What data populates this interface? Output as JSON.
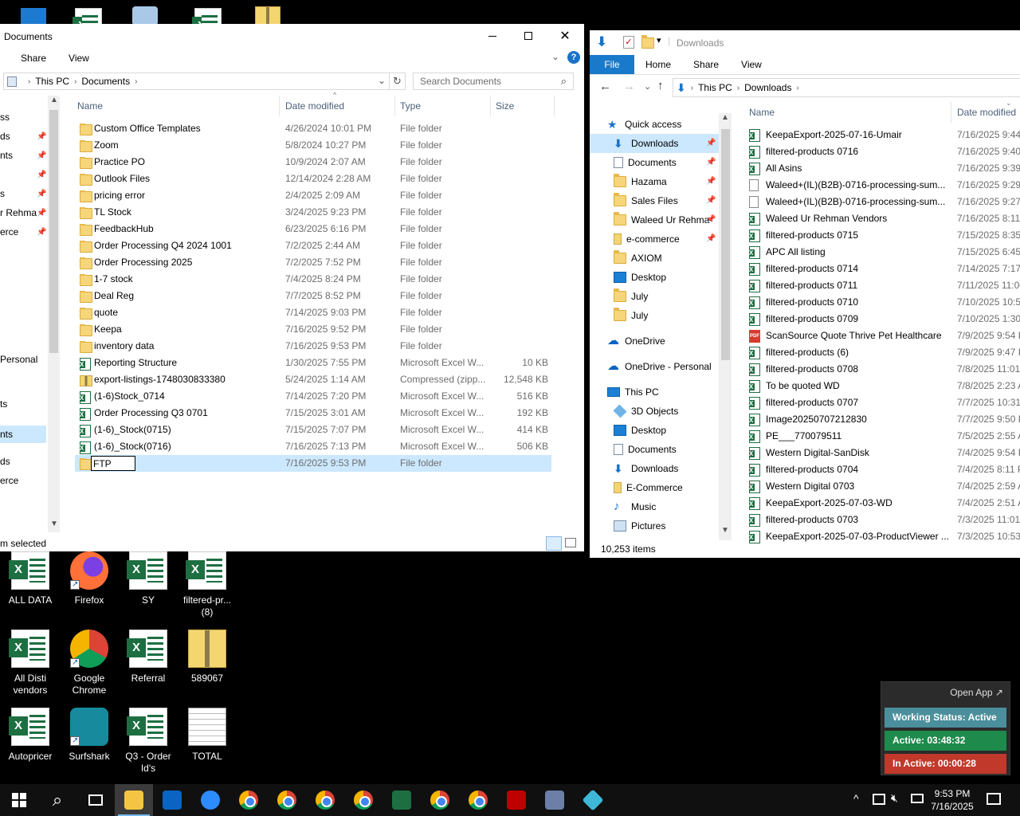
{
  "desktop": {
    "icons": [
      {
        "label": "ALL DATA",
        "type": "excel"
      },
      {
        "label": "Firefox",
        "type": "firefox"
      },
      {
        "label": "SY",
        "type": "excel"
      },
      {
        "label": "filtered-pr... (8)",
        "type": "excel"
      },
      {
        "label": "All Disti vendors",
        "type": "excel"
      },
      {
        "label": "Google Chrome",
        "type": "chrome"
      },
      {
        "label": "Referral",
        "type": "excel"
      },
      {
        "label": "589067",
        "type": "zip"
      },
      {
        "label": "Autopricer",
        "type": "excel"
      },
      {
        "label": "Surfshark",
        "type": "surfshark"
      },
      {
        "label": "Q3 - Order Id's",
        "type": "excel"
      },
      {
        "label": "TOTAL",
        "type": "document"
      }
    ]
  },
  "left_window": {
    "title": "Documents",
    "ribbon_tabs": [
      "Share",
      "View"
    ],
    "address": {
      "root": "This PC",
      "folder": "Documents"
    },
    "search_placeholder": "Search Documents",
    "columns": [
      "Name",
      "Date modified",
      "Type",
      "Size"
    ],
    "rows": [
      {
        "name": "Custom Office Templates",
        "date": "4/26/2024 10:01 PM",
        "type": "File folder",
        "size": "",
        "icon": "folder"
      },
      {
        "name": "Zoom",
        "date": "5/8/2024 10:27 PM",
        "type": "File folder",
        "size": "",
        "icon": "folder"
      },
      {
        "name": "Practice PO",
        "date": "10/9/2024 2:07 AM",
        "type": "File folder",
        "size": "",
        "icon": "folder"
      },
      {
        "name": "Outlook Files",
        "date": "12/14/2024 2:28 AM",
        "type": "File folder",
        "size": "",
        "icon": "folder"
      },
      {
        "name": "pricing error",
        "date": "2/4/2025 2:09 AM",
        "type": "File folder",
        "size": "",
        "icon": "folder"
      },
      {
        "name": "TL Stock",
        "date": "3/24/2025 9:23 PM",
        "type": "File folder",
        "size": "",
        "icon": "folder"
      },
      {
        "name": "FeedbackHub",
        "date": "6/23/2025 6:16 PM",
        "type": "File folder",
        "size": "",
        "icon": "folder"
      },
      {
        "name": "Order Processing Q4 2024 1001",
        "date": "7/2/2025 2:44 AM",
        "type": "File folder",
        "size": "",
        "icon": "folder"
      },
      {
        "name": "Order Processing 2025",
        "date": "7/2/2025 7:52 PM",
        "type": "File folder",
        "size": "",
        "icon": "folder"
      },
      {
        "name": "1-7 stock",
        "date": "7/4/2025 8:24 PM",
        "type": "File folder",
        "size": "",
        "icon": "folder"
      },
      {
        "name": "Deal Reg",
        "date": "7/7/2025 8:52 PM",
        "type": "File folder",
        "size": "",
        "icon": "folder"
      },
      {
        "name": "quote",
        "date": "7/14/2025 9:03 PM",
        "type": "File folder",
        "size": "",
        "icon": "folder"
      },
      {
        "name": "Keepa",
        "date": "7/16/2025 9:52 PM",
        "type": "File folder",
        "size": "",
        "icon": "folder"
      },
      {
        "name": "inventory data",
        "date": "7/16/2025 9:53 PM",
        "type": "File folder",
        "size": "",
        "icon": "folder"
      },
      {
        "name": "Reporting Structure",
        "date": "1/30/2025 7:55 PM",
        "type": "Microsoft Excel W...",
        "size": "10 KB",
        "icon": "excel"
      },
      {
        "name": "export-listings-1748030833380",
        "date": "5/24/2025 1:14 AM",
        "type": "Compressed (zipp...",
        "size": "12,548 KB",
        "icon": "zip"
      },
      {
        "name": "(1-6)Stock_0714",
        "date": "7/14/2025 7:20 PM",
        "type": "Microsoft Excel W...",
        "size": "516 KB",
        "icon": "excel"
      },
      {
        "name": "Order Processing Q3 0701",
        "date": "7/15/2025 3:01 AM",
        "type": "Microsoft Excel W...",
        "size": "192 KB",
        "icon": "excel"
      },
      {
        "name": "(1-6)_Stock(0715)",
        "date": "7/15/2025 7:07 PM",
        "type": "Microsoft Excel W...",
        "size": "414 KB",
        "icon": "excel"
      },
      {
        "name": "(1-6)_Stock(0716)",
        "date": "7/16/2025 7:13 PM",
        "type": "Microsoft Excel W...",
        "size": "506 KB",
        "icon": "excel"
      }
    ],
    "rename_row": {
      "value": "FTP",
      "date": "7/16/2025 9:53 PM",
      "type": "File folder"
    },
    "nav_fragments": [
      "ss",
      "ds",
      "nts",
      "",
      "s",
      "r Rehma",
      "erce",
      "Personal",
      "ts",
      "nts",
      "ds",
      "erce"
    ],
    "status": "m selected"
  },
  "right_window": {
    "title": "Downloads",
    "ribbon_tabs": [
      "File",
      "Home",
      "Share",
      "View"
    ],
    "address": {
      "root": "This PC",
      "folder": "Downloads"
    },
    "columns": [
      "Name",
      "Date modified"
    ],
    "nav": [
      {
        "label": "Quick access",
        "icon": "star",
        "pinned": false
      },
      {
        "label": "Downloads",
        "icon": "download",
        "pinned": true,
        "selected": true
      },
      {
        "label": "Documents",
        "icon": "document",
        "pinned": true
      },
      {
        "label": "Hazama",
        "icon": "folder",
        "pinned": true
      },
      {
        "label": "Sales Files",
        "icon": "folder",
        "pinned": true
      },
      {
        "label": "Waleed Ur Rehma",
        "icon": "folder",
        "pinned": true
      },
      {
        "label": "e-commerce",
        "icon": "folder-shared",
        "pinned": true
      },
      {
        "label": "AXIOM",
        "icon": "folder",
        "pinned": false
      },
      {
        "label": "Desktop",
        "icon": "desktop",
        "pinned": false
      },
      {
        "label": "July",
        "icon": "folder",
        "pinned": false
      },
      {
        "label": "July",
        "icon": "folder",
        "pinned": false
      },
      {
        "label": "OneDrive",
        "icon": "cloud",
        "pinned": false
      },
      {
        "label": "OneDrive - Personal",
        "icon": "cloud",
        "pinned": false
      },
      {
        "label": "This PC",
        "icon": "pc",
        "pinned": false
      },
      {
        "label": "3D Objects",
        "icon": "cube",
        "pinned": false
      },
      {
        "label": "Desktop",
        "icon": "desktop",
        "pinned": false
      },
      {
        "label": "Documents",
        "icon": "document",
        "pinned": false
      },
      {
        "label": "Downloads",
        "icon": "download",
        "pinned": false
      },
      {
        "label": "E-Commerce",
        "icon": "folder-shared",
        "pinned": false
      },
      {
        "label": "Music",
        "icon": "music",
        "pinned": false
      },
      {
        "label": "Pictures",
        "icon": "picture",
        "pinned": false
      }
    ],
    "rows": [
      {
        "name": "KeepaExport-2025-07-16-Umair",
        "date": "7/16/2025 9:44",
        "icon": "excel"
      },
      {
        "name": "filtered-products 0716",
        "date": "7/16/2025 9:40",
        "icon": "excel"
      },
      {
        "name": "All Asins",
        "date": "7/16/2025 9:39",
        "icon": "excel"
      },
      {
        "name": "Waleed+(IL)(B2B)-0716-processing-sum...",
        "date": "7/16/2025 9:29",
        "icon": "document"
      },
      {
        "name": "Waleed+(IL)(B2B)-0716-processing-sum...",
        "date": "7/16/2025 9:27",
        "icon": "document"
      },
      {
        "name": "Waleed Ur Rehman Vendors",
        "date": "7/16/2025 8:11",
        "icon": "excel"
      },
      {
        "name": "filtered-products 0715",
        "date": "7/15/2025 8:35",
        "icon": "excel"
      },
      {
        "name": "APC All listing",
        "date": "7/15/2025 6:45",
        "icon": "excel"
      },
      {
        "name": "filtered-products 0714",
        "date": "7/14/2025 7:17",
        "icon": "excel"
      },
      {
        "name": "filtered-products 0711",
        "date": "7/11/2025 11:00",
        "icon": "excel"
      },
      {
        "name": "filtered-products 0710",
        "date": "7/10/2025 10:55",
        "icon": "excel"
      },
      {
        "name": "filtered-products 0709",
        "date": "7/10/2025 1:30",
        "icon": "excel"
      },
      {
        "name": "ScanSource Quote Thrive Pet Healthcare",
        "date": "7/9/2025 9:54 P",
        "icon": "pdf"
      },
      {
        "name": "filtered-products (6)",
        "date": "7/9/2025 9:47 P",
        "icon": "excel"
      },
      {
        "name": "filtered-products 0708",
        "date": "7/8/2025 11:01",
        "icon": "excel"
      },
      {
        "name": "To be quoted WD",
        "date": "7/8/2025 2:23 A",
        "icon": "excel"
      },
      {
        "name": "filtered-products 0707",
        "date": "7/7/2025 10:31",
        "icon": "excel"
      },
      {
        "name": "Image20250707212830",
        "date": "7/7/2025 9:50 P",
        "icon": "excel"
      },
      {
        "name": "PE___770079511",
        "date": "7/5/2025 2:55 A",
        "icon": "excel"
      },
      {
        "name": "Western Digital-SanDisk",
        "date": "7/4/2025 9:54 P",
        "icon": "excel"
      },
      {
        "name": "filtered-products 0704",
        "date": "7/4/2025 8:11 P",
        "icon": "excel"
      },
      {
        "name": "Western Digital 0703",
        "date": "7/4/2025 2:59 A",
        "icon": "excel"
      },
      {
        "name": "KeepaExport-2025-07-03-WD",
        "date": "7/4/2025 2:51 A",
        "icon": "excel"
      },
      {
        "name": "filtered-products 0703",
        "date": "7/3/2025 11:01",
        "icon": "excel"
      },
      {
        "name": "KeepaExport-2025-07-03-ProductViewer ...",
        "date": "7/3/2025 10:53",
        "icon": "excel"
      }
    ],
    "status": "10,253 items"
  },
  "tracker": {
    "open_app": "Open App ↗",
    "working_status": "Working Status: Active",
    "active": "Active: 03:48:32",
    "inactive": "In Active: 00:00:28",
    "colors": {
      "status": "#4a8f9b",
      "active": "#1e8a4c",
      "inactive": "#c0392b"
    }
  },
  "taskbar": {
    "apps": [
      "File Explorer",
      "Outlook",
      "Zoom",
      "Chrome",
      "Chrome",
      "Chrome",
      "Chrome",
      "Excel",
      "Chrome",
      "Chrome",
      "FileZilla",
      "Calculator",
      "App"
    ],
    "time": "9:53 PM",
    "date": "7/16/2025"
  }
}
